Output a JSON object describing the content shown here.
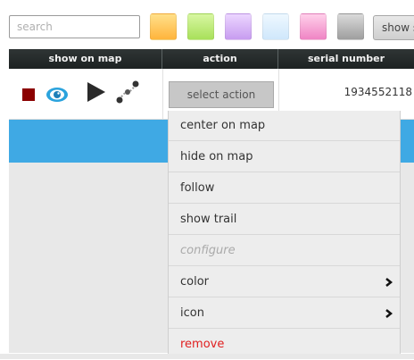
{
  "search": {
    "placeholder": "search"
  },
  "color_swatches": [
    {
      "name": "orange",
      "top": "#ffe08a",
      "bottom": "#ffb43c"
    },
    {
      "name": "green",
      "top": "#d8f7a2",
      "bottom": "#a8e05a"
    },
    {
      "name": "purple",
      "top": "#ecd6ff",
      "bottom": "#c79cf0"
    },
    {
      "name": "light-blue",
      "top": "#eef8ff",
      "bottom": "#cfe7fb"
    },
    {
      "name": "pink",
      "top": "#ffd0ea",
      "bottom": "#ef84c4"
    },
    {
      "name": "gray",
      "top": "#dadada",
      "bottom": "#9e9e9e"
    }
  ],
  "show_button": {
    "label": "show s"
  },
  "table": {
    "headers": {
      "show_on_map": "show on map",
      "action": "action",
      "serial_number": "serial number"
    },
    "rows": [
      {
        "action_label": "select action",
        "serial": "1934552118"
      }
    ]
  },
  "colors": {
    "selected_row": "#3fa9e4",
    "stop": "#8b0000",
    "eye": "#2ba3dd",
    "remove": "#e02020"
  },
  "icons": [
    "stop-icon",
    "eye-icon",
    "play-icon",
    "trail-icon"
  ],
  "menu": {
    "items": [
      {
        "label": "center on map",
        "state": "normal"
      },
      {
        "label": "hide on map",
        "state": "normal"
      },
      {
        "label": "follow",
        "state": "normal"
      },
      {
        "label": "show trail",
        "state": "normal"
      },
      {
        "label": "configure",
        "state": "disabled"
      },
      {
        "label": "color",
        "state": "submenu"
      },
      {
        "label": "icon",
        "state": "submenu"
      },
      {
        "label": "remove",
        "state": "danger"
      }
    ]
  }
}
